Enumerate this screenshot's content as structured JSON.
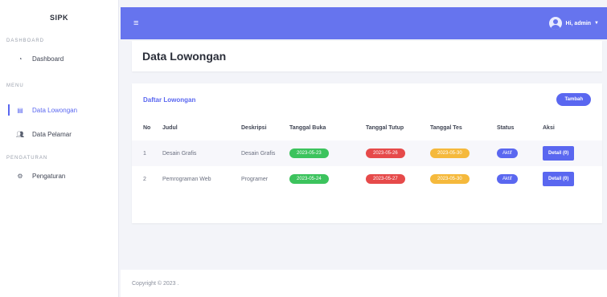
{
  "sidebar": {
    "brand": "SIPK",
    "sections": [
      "DASHBOARD",
      "MENU",
      "PENGATURAN"
    ],
    "items": [
      {
        "label": "Dashboard",
        "icon": "dashboard-icon"
      },
      {
        "label": "Data Lowongan",
        "icon": "table-icon",
        "active": true
      },
      {
        "label": "Data Pelamar",
        "icon": "users-icon"
      },
      {
        "label": "Pengaturan",
        "icon": "gear-icon"
      }
    ]
  },
  "topbar": {
    "menu_icon": "hamburger-icon",
    "user_label": "Hi, admin"
  },
  "page": {
    "title": "Data Lowongan"
  },
  "card": {
    "title": "Daftar Lowongan",
    "add_label": "Tambah"
  },
  "table": {
    "headers": [
      "No",
      "Judul",
      "Deskripsi",
      "Tanggal Buka",
      "Tanggal Tutup",
      "Tanggal Tes",
      "Status",
      "Aksi"
    ],
    "rows": [
      {
        "no": "1",
        "judul": "Desain Grafis",
        "deskripsi": "Desain Grafis",
        "buka": "2023-05-23",
        "tutup": "2023-05-26",
        "tes": "2023-05-30",
        "status": "Aktif",
        "aksi": "Detail (0)"
      },
      {
        "no": "2",
        "judul": "Pemrograman Web",
        "deskripsi": "Programer",
        "buka": "2023-05-24",
        "tutup": "2023-05-27",
        "tes": "2023-05-30",
        "status": "Aktif",
        "aksi": "Detail (0)"
      }
    ]
  },
  "footer": {
    "text": "Copyright © 2023 ."
  },
  "colors": {
    "primary": "#6674ee",
    "green": "#3cc35d",
    "red": "#e64a4a",
    "yellow": "#f5b93c"
  }
}
